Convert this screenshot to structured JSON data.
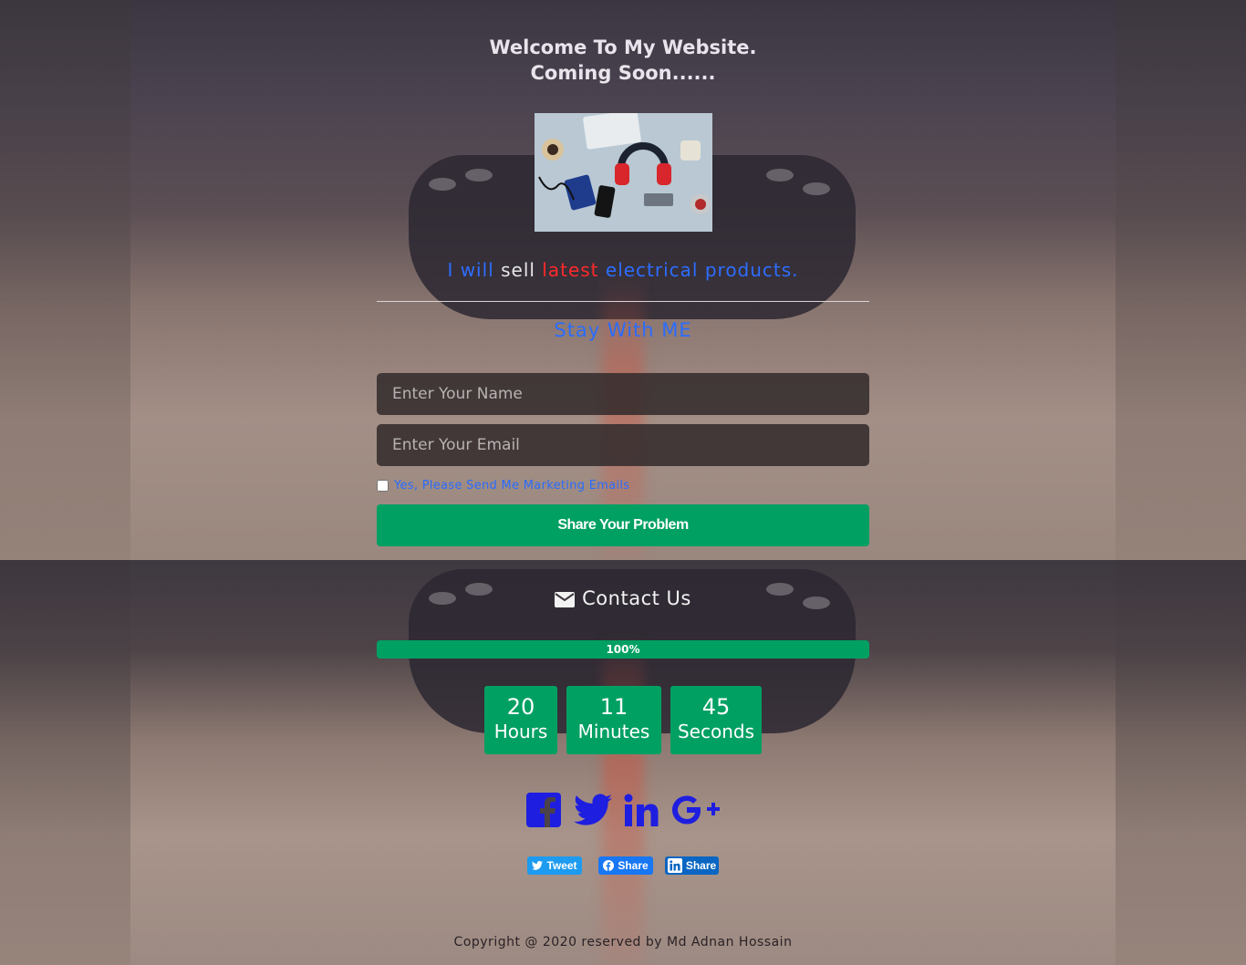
{
  "header": {
    "welcome_line1": "Welcome To My Website.",
    "welcome_line2": "Coming Soon......"
  },
  "tagline": {
    "word1": "I will",
    "word2": "sell",
    "word3": "latest",
    "word4": "electrical products."
  },
  "stay": "Stay With ME",
  "form": {
    "name_placeholder": "Enter Your Name",
    "email_placeholder": "Enter Your Email",
    "marketing_label": "Yes, Please Send Me Marketing Emails",
    "submit_label": "Share Your Problem"
  },
  "contact": {
    "label": "Contact Us",
    "icon": "envelope-icon"
  },
  "progress": {
    "value": 1.0,
    "label": "100%"
  },
  "countdown": {
    "hours_value": "20",
    "hours_label": "Hours",
    "minutes_value": "11",
    "minutes_label": "Minutes",
    "seconds_value": "45",
    "seconds_label": "Seconds"
  },
  "social_icons": [
    "facebook-icon",
    "twitter-icon",
    "linkedin-icon",
    "google-plus-icon"
  ],
  "share": {
    "tweet_label": "Tweet",
    "facebook_label": "Share",
    "linkedin_label": "Share"
  },
  "footer": "Copyright @ 2020 reserved by Md Adnan Hossain",
  "colors": {
    "accent_green": "#00a063",
    "accent_blue": "#2a6cff",
    "social_icon_blue": "#1e1ee0",
    "highlight_red": "#ff2a2a"
  }
}
